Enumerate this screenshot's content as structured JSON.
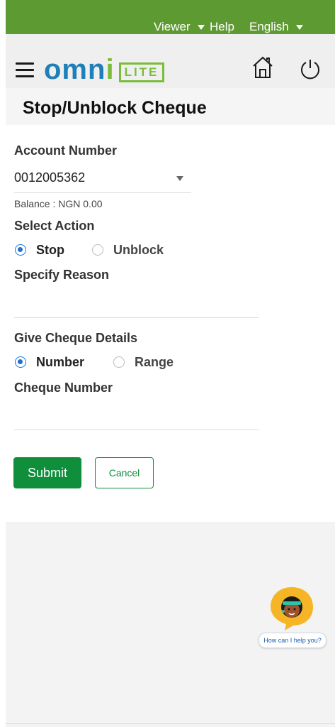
{
  "topbar": {
    "viewer_label": "Viewer",
    "help_label": "Help",
    "language_label": "English"
  },
  "header": {
    "logo_text": "omni",
    "logo_badge": "LITE"
  },
  "page": {
    "title": "Stop/Unblock Cheque"
  },
  "form": {
    "account_label": "Account Number",
    "account_value": "0012005362",
    "balance_text": "Balance : NGN 0.00",
    "select_action_label": "Select Action",
    "action_options": [
      {
        "label": "Stop",
        "selected": true
      },
      {
        "label": "Unblock",
        "selected": false
      }
    ],
    "reason_label": "Specify Reason",
    "reason_value": "",
    "cheque_details_label": "Give Cheque Details",
    "detail_options": [
      {
        "label": "Number",
        "selected": true
      },
      {
        "label": "Range",
        "selected": false
      }
    ],
    "cheque_number_label": "Cheque Number",
    "cheque_number_value": "",
    "submit_label": "Submit",
    "cancel_label": "Cancel"
  },
  "assistant": {
    "prompt": "How can I help you?"
  },
  "colors": {
    "topbar": "#5e9a32",
    "primary_green": "#0f8f3c",
    "radio_blue": "#1a73d9",
    "logo_blue": "#1f7fb8",
    "logo_green": "#7bbd3a"
  },
  "icons": [
    "menu-icon",
    "home-icon",
    "power-icon",
    "caret-down-icon",
    "assistant-avatar-icon"
  ]
}
